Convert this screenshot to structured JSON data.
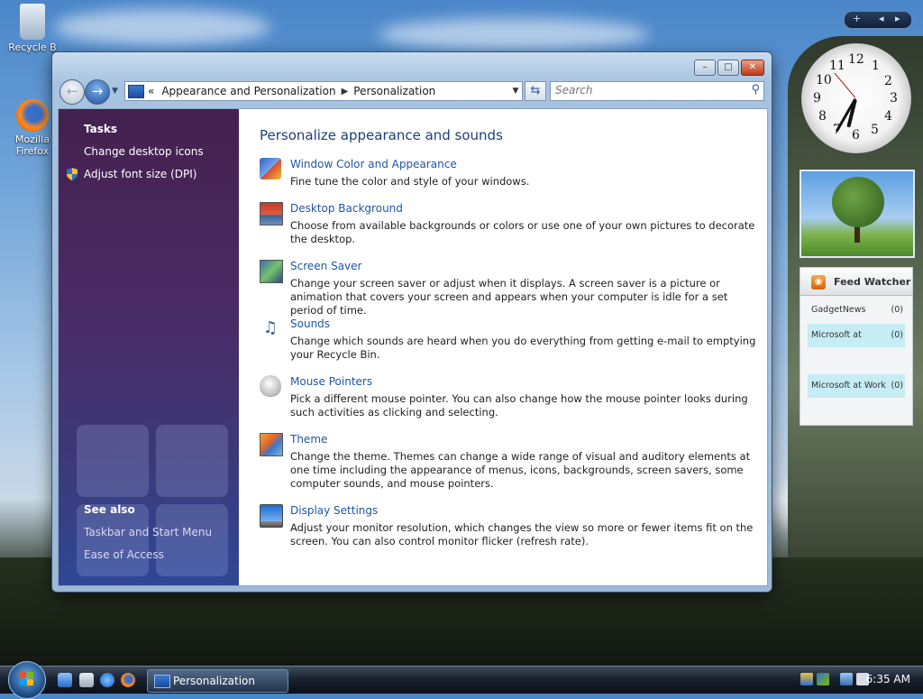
{
  "desktop": {
    "icons": [
      {
        "label": "Recycle B"
      },
      {
        "label": "Mozilla Firefox"
      }
    ]
  },
  "window": {
    "title": "Personalization",
    "controls": {
      "minimize": "–",
      "maximize": "□",
      "close": "✕"
    },
    "address": {
      "chevron": "«",
      "crumbs": [
        "Appearance and Personalization",
        "Personalization"
      ]
    },
    "search": {
      "placeholder": "Search"
    }
  },
  "sidebar": {
    "tasks_title": "Tasks",
    "tasks": [
      "Change desktop icons",
      "Adjust font size (DPI)"
    ],
    "see_also_title": "See also",
    "see_also": [
      "Taskbar and Start Menu",
      "Ease of Access"
    ]
  },
  "main": {
    "heading": "Personalize appearance and sounds",
    "items": [
      {
        "link": "Window Color and Appearance",
        "desc": "Fine tune the color and style of your windows.",
        "icon": "window-color-icon"
      },
      {
        "link": "Desktop Background",
        "desc": "Choose from available backgrounds or colors or use one of your own pictures to decorate the desktop.",
        "icon": "desktop-background-icon"
      },
      {
        "link": "Screen Saver",
        "desc": "Change your screen saver or adjust when it displays. A screen saver is a picture or animation that covers your screen and appears when your computer is idle for a set period of time.",
        "icon": "screen-saver-icon"
      },
      {
        "link": "Sounds",
        "desc": "Change which sounds are heard when you do everything from getting e-mail to emptying your Recycle Bin.",
        "icon": "sounds-icon"
      },
      {
        "link": "Mouse Pointers",
        "desc": "Pick a different mouse pointer. You can also change how the mouse pointer looks during such activities as clicking and selecting.",
        "icon": "mouse-pointers-icon"
      },
      {
        "link": "Theme",
        "desc": "Change the theme. Themes can change a wide range of visual and auditory elements at one time including the appearance of menus, icons, backgrounds, screen savers, some computer sounds, and mouse pointers.",
        "icon": "theme-icon"
      },
      {
        "link": "Display Settings",
        "desc": "Adjust your monitor resolution, which changes the view so more or fewer items fit on the screen. You can also control monitor flicker (refresh rate).",
        "icon": "display-settings-icon"
      }
    ]
  },
  "gadgets": {
    "bar": {
      "add": "+",
      "prev": "◂",
      "next": "▸"
    },
    "clock": {
      "numbers": [
        "12",
        "1",
        "2",
        "3",
        "4",
        "5",
        "6",
        "7",
        "8",
        "9",
        "10",
        "11"
      ]
    },
    "feed": {
      "title": "Feed Watcher",
      "rows": [
        {
          "name": "GadgetNews",
          "count": "(0)"
        },
        {
          "name": "Microsoft at",
          "count": "(0)"
        },
        {
          "name": "Microsoft at Work",
          "count": "(0)"
        }
      ]
    }
  },
  "taskbar": {
    "active_task": "Personalization",
    "time": "6:35 AM"
  },
  "colors": {
    "link": "#1e56a8",
    "heading": "#1e3e7a",
    "sidebar_top": "#44214f",
    "sidebar_bottom": "#2f4796"
  }
}
